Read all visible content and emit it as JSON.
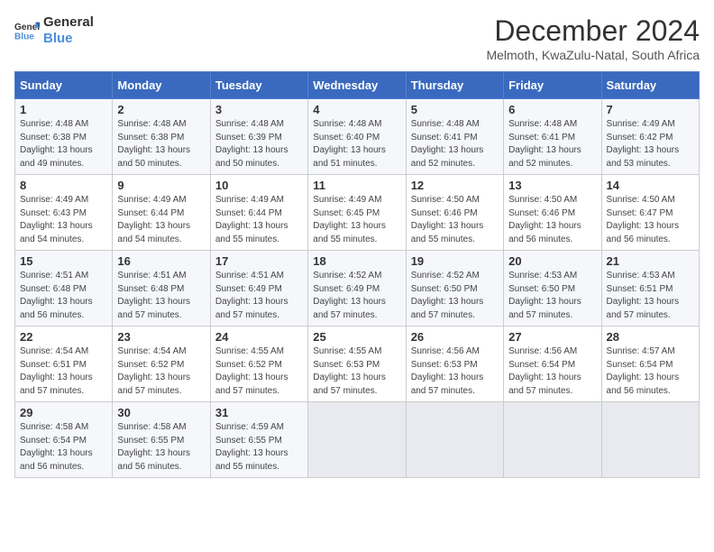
{
  "header": {
    "logo_line1": "General",
    "logo_line2": "Blue",
    "month_title": "December 2024",
    "location": "Melmoth, KwaZulu-Natal, South Africa"
  },
  "days_of_week": [
    "Sunday",
    "Monday",
    "Tuesday",
    "Wednesday",
    "Thursday",
    "Friday",
    "Saturday"
  ],
  "weeks": [
    [
      {
        "day": "1",
        "info": "Sunrise: 4:48 AM\nSunset: 6:38 PM\nDaylight: 13 hours\nand 49 minutes."
      },
      {
        "day": "2",
        "info": "Sunrise: 4:48 AM\nSunset: 6:38 PM\nDaylight: 13 hours\nand 50 minutes."
      },
      {
        "day": "3",
        "info": "Sunrise: 4:48 AM\nSunset: 6:39 PM\nDaylight: 13 hours\nand 50 minutes."
      },
      {
        "day": "4",
        "info": "Sunrise: 4:48 AM\nSunset: 6:40 PM\nDaylight: 13 hours\nand 51 minutes."
      },
      {
        "day": "5",
        "info": "Sunrise: 4:48 AM\nSunset: 6:41 PM\nDaylight: 13 hours\nand 52 minutes."
      },
      {
        "day": "6",
        "info": "Sunrise: 4:48 AM\nSunset: 6:41 PM\nDaylight: 13 hours\nand 52 minutes."
      },
      {
        "day": "7",
        "info": "Sunrise: 4:49 AM\nSunset: 6:42 PM\nDaylight: 13 hours\nand 53 minutes."
      }
    ],
    [
      {
        "day": "8",
        "info": "Sunrise: 4:49 AM\nSunset: 6:43 PM\nDaylight: 13 hours\nand 54 minutes."
      },
      {
        "day": "9",
        "info": "Sunrise: 4:49 AM\nSunset: 6:44 PM\nDaylight: 13 hours\nand 54 minutes."
      },
      {
        "day": "10",
        "info": "Sunrise: 4:49 AM\nSunset: 6:44 PM\nDaylight: 13 hours\nand 55 minutes."
      },
      {
        "day": "11",
        "info": "Sunrise: 4:49 AM\nSunset: 6:45 PM\nDaylight: 13 hours\nand 55 minutes."
      },
      {
        "day": "12",
        "info": "Sunrise: 4:50 AM\nSunset: 6:46 PM\nDaylight: 13 hours\nand 55 minutes."
      },
      {
        "day": "13",
        "info": "Sunrise: 4:50 AM\nSunset: 6:46 PM\nDaylight: 13 hours\nand 56 minutes."
      },
      {
        "day": "14",
        "info": "Sunrise: 4:50 AM\nSunset: 6:47 PM\nDaylight: 13 hours\nand 56 minutes."
      }
    ],
    [
      {
        "day": "15",
        "info": "Sunrise: 4:51 AM\nSunset: 6:48 PM\nDaylight: 13 hours\nand 56 minutes."
      },
      {
        "day": "16",
        "info": "Sunrise: 4:51 AM\nSunset: 6:48 PM\nDaylight: 13 hours\nand 57 minutes."
      },
      {
        "day": "17",
        "info": "Sunrise: 4:51 AM\nSunset: 6:49 PM\nDaylight: 13 hours\nand 57 minutes."
      },
      {
        "day": "18",
        "info": "Sunrise: 4:52 AM\nSunset: 6:49 PM\nDaylight: 13 hours\nand 57 minutes."
      },
      {
        "day": "19",
        "info": "Sunrise: 4:52 AM\nSunset: 6:50 PM\nDaylight: 13 hours\nand 57 minutes."
      },
      {
        "day": "20",
        "info": "Sunrise: 4:53 AM\nSunset: 6:50 PM\nDaylight: 13 hours\nand 57 minutes."
      },
      {
        "day": "21",
        "info": "Sunrise: 4:53 AM\nSunset: 6:51 PM\nDaylight: 13 hours\nand 57 minutes."
      }
    ],
    [
      {
        "day": "22",
        "info": "Sunrise: 4:54 AM\nSunset: 6:51 PM\nDaylight: 13 hours\nand 57 minutes."
      },
      {
        "day": "23",
        "info": "Sunrise: 4:54 AM\nSunset: 6:52 PM\nDaylight: 13 hours\nand 57 minutes."
      },
      {
        "day": "24",
        "info": "Sunrise: 4:55 AM\nSunset: 6:52 PM\nDaylight: 13 hours\nand 57 minutes."
      },
      {
        "day": "25",
        "info": "Sunrise: 4:55 AM\nSunset: 6:53 PM\nDaylight: 13 hours\nand 57 minutes."
      },
      {
        "day": "26",
        "info": "Sunrise: 4:56 AM\nSunset: 6:53 PM\nDaylight: 13 hours\nand 57 minutes."
      },
      {
        "day": "27",
        "info": "Sunrise: 4:56 AM\nSunset: 6:54 PM\nDaylight: 13 hours\nand 57 minutes."
      },
      {
        "day": "28",
        "info": "Sunrise: 4:57 AM\nSunset: 6:54 PM\nDaylight: 13 hours\nand 56 minutes."
      }
    ],
    [
      {
        "day": "29",
        "info": "Sunrise: 4:58 AM\nSunset: 6:54 PM\nDaylight: 13 hours\nand 56 minutes."
      },
      {
        "day": "30",
        "info": "Sunrise: 4:58 AM\nSunset: 6:55 PM\nDaylight: 13 hours\nand 56 minutes."
      },
      {
        "day": "31",
        "info": "Sunrise: 4:59 AM\nSunset: 6:55 PM\nDaylight: 13 hours\nand 55 minutes."
      },
      {
        "day": "",
        "info": ""
      },
      {
        "day": "",
        "info": ""
      },
      {
        "day": "",
        "info": ""
      },
      {
        "day": "",
        "info": ""
      }
    ]
  ]
}
